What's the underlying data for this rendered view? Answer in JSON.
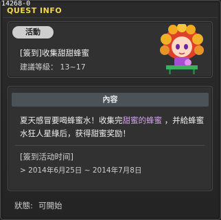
{
  "window": {
    "id_label": "14268-0",
    "title": "QUEST INFO"
  },
  "quest": {
    "badge": "活動",
    "name": "[簽到]收集甜甜蜂蜜",
    "level_requirement": "建議等級： 13~17",
    "npc_icon": "npc-girl-portrait-icon"
  },
  "details": {
    "section_title": "內容",
    "description_part1": "夏天感冒要喝蜂蜜水！收集完",
    "description_highlight": "甜蜜的蜂蜜",
    "description_part2": " ，并給蜂蜜水狂人星綠后，获得甜蜜奖励！",
    "time_label": "[簽到活动时间]",
    "time_range": "> 2014年6月25日 ~ 2014年7月8日"
  },
  "status": {
    "label": "狀態:",
    "value": "可開始"
  },
  "colors": {
    "title": "#f2d84a",
    "highlight": "#d7a1f0",
    "section_bar": "#4c5358"
  }
}
